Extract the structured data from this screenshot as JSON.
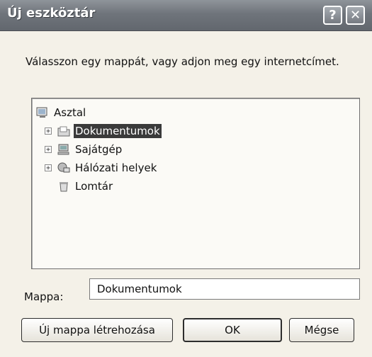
{
  "window": {
    "title": "Új eszköztár",
    "help_label": "?",
    "close_label": "✕"
  },
  "prompt": "Válasszon egy mappát, vagy adjon meg egy internetcímet.",
  "tree": {
    "root": {
      "label": "Asztal",
      "icon": "desktop-icon"
    },
    "items": [
      {
        "label": "Dokumentumok",
        "icon": "documents-folder-icon",
        "selected": true,
        "expander": "+"
      },
      {
        "label": "Sajátgép",
        "icon": "computer-icon",
        "selected": false,
        "expander": "+"
      },
      {
        "label": "Hálózati helyek",
        "icon": "network-places-icon",
        "selected": false,
        "expander": "+"
      },
      {
        "label": "Lomtár",
        "icon": "recycle-bin-icon",
        "selected": false,
        "expander": ""
      }
    ]
  },
  "folder_field": {
    "label": "Mappa:",
    "value": "Dokumentumok"
  },
  "buttons": {
    "new_folder": "Új mappa létrehozása",
    "ok": "OK",
    "cancel": "Mégse"
  }
}
